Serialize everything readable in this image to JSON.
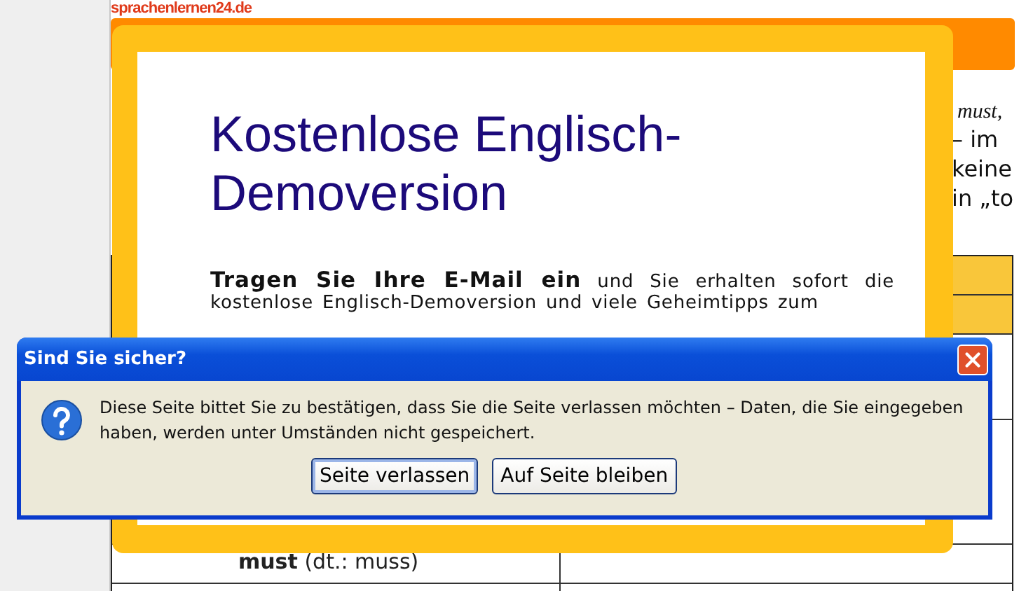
{
  "site": {
    "logo": "sprachenlernen24.de",
    "text_fragments": [
      "must,",
      "– im",
      "keine",
      "in „to"
    ],
    "table": {
      "rows": [
        {
          "kind": "header",
          "cells": [
            "",
            ""
          ]
        },
        {
          "kind": "header",
          "cells": [
            "",
            ""
          ]
        },
        {
          "kind": "body",
          "cells": [
            "",
            ""
          ]
        },
        {
          "kind": "body",
          "cells": [
            "",
            ""
          ]
        },
        {
          "kind": "body",
          "cells": [
            "**must** (dt.: muss)",
            ""
          ]
        },
        {
          "kind": "body",
          "cells": [
            "",
            ""
          ]
        }
      ]
    }
  },
  "popup": {
    "title": "Kostenlose Englisch-Demoversion",
    "intro": "**Tragen Sie Ihre E-Mail ein** und Sie erhalten sofort die kostenlose Englisch-Demoversion und viele Geheimtipps zum"
  },
  "dialog": {
    "title": "Sind Sie sicher?",
    "message": "Diese Seite bittet Sie zu bestätigen, dass Sie die Seite verlassen möchten – Daten, die Sie eingegeben haben, werden unter Umständen nicht gespeichert.",
    "buttons": [
      {
        "label": "Seite verlassen",
        "default": true
      },
      {
        "label": "Auf Seite bleiben",
        "default": false
      }
    ]
  }
}
